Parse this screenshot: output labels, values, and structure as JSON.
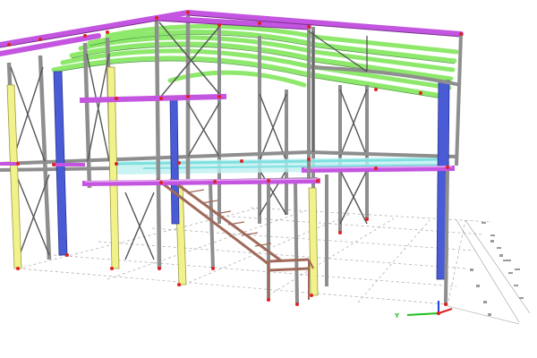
{
  "viewport": {
    "background": "#ffffff",
    "view": "3d-perspective",
    "model": "steel-frame-structure"
  },
  "colors": {
    "rafter": "#c455e0",
    "purlin": "#8ee86c",
    "column_yellow": "#f2f28a",
    "column_blue": "#4a5bd6",
    "member_grey": "#8e8e8e",
    "brace_dark": "#555555",
    "floor_cyan": "#7fe0e0",
    "stair_brown": "#a06a5a",
    "node": "#e02020",
    "grid": "#9a9a9a"
  },
  "axis_triad": {
    "x_label": "",
    "y_label": "Y",
    "x_color": "#e02020",
    "y_color": "#20c020",
    "z_color": "#2040e0"
  }
}
